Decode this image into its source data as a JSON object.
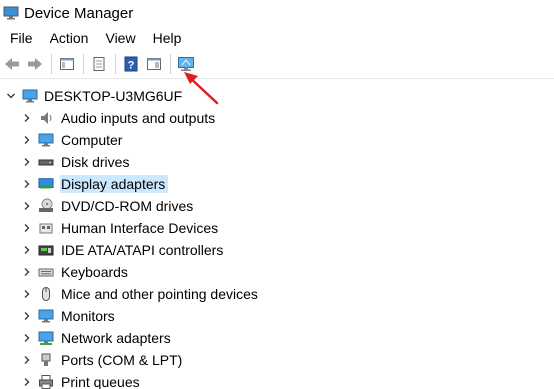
{
  "window": {
    "title": "Device Manager"
  },
  "menu": {
    "items": [
      "File",
      "Action",
      "View",
      "Help"
    ]
  },
  "tree": {
    "root_label": "DESKTOP-U3MG6UF",
    "items": [
      {
        "label": "Audio inputs and outputs",
        "icon": "speaker-icon"
      },
      {
        "label": "Computer",
        "icon": "computer-icon"
      },
      {
        "label": "Disk drives",
        "icon": "disk-drive-icon"
      },
      {
        "label": "Display adapters",
        "icon": "display-adapter-icon"
      },
      {
        "label": "DVD/CD-ROM drives",
        "icon": "dvd-drive-icon"
      },
      {
        "label": "Human Interface Devices",
        "icon": "hid-icon"
      },
      {
        "label": "IDE ATA/ATAPI controllers",
        "icon": "ide-controller-icon"
      },
      {
        "label": "Keyboards",
        "icon": "keyboard-icon"
      },
      {
        "label": "Mice and other pointing devices",
        "icon": "mouse-icon"
      },
      {
        "label": "Monitors",
        "icon": "monitor-icon"
      },
      {
        "label": "Network adapters",
        "icon": "network-adapter-icon"
      },
      {
        "label": "Ports (COM & LPT)",
        "icon": "port-icon"
      },
      {
        "label": "Print queues",
        "icon": "printer-icon"
      }
    ],
    "selected_index": 3
  },
  "colors": {
    "selection": "#cce8ff",
    "annotation_arrow": "#e02020"
  }
}
